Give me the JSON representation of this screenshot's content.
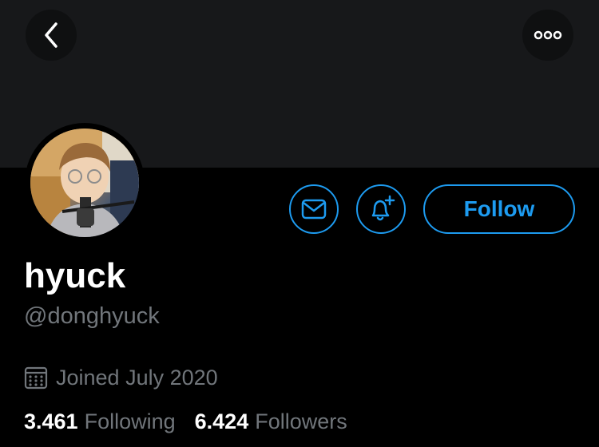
{
  "header": {
    "back_icon": "chevron-left-icon",
    "more_icon": "more-horizontal-icon"
  },
  "actions": {
    "message_icon": "mail-icon",
    "notify_icon": "bell-plus-icon",
    "follow_label": "Follow",
    "accent_color": "#1d9bf0"
  },
  "profile": {
    "display_name": "hyuck",
    "handle": "@donghyuck",
    "joined": "Joined July 2020",
    "joined_icon": "calendar-icon"
  },
  "stats": {
    "following_count": "3.461",
    "following_label": "Following",
    "followers_count": "6.424",
    "followers_label": "Followers"
  }
}
